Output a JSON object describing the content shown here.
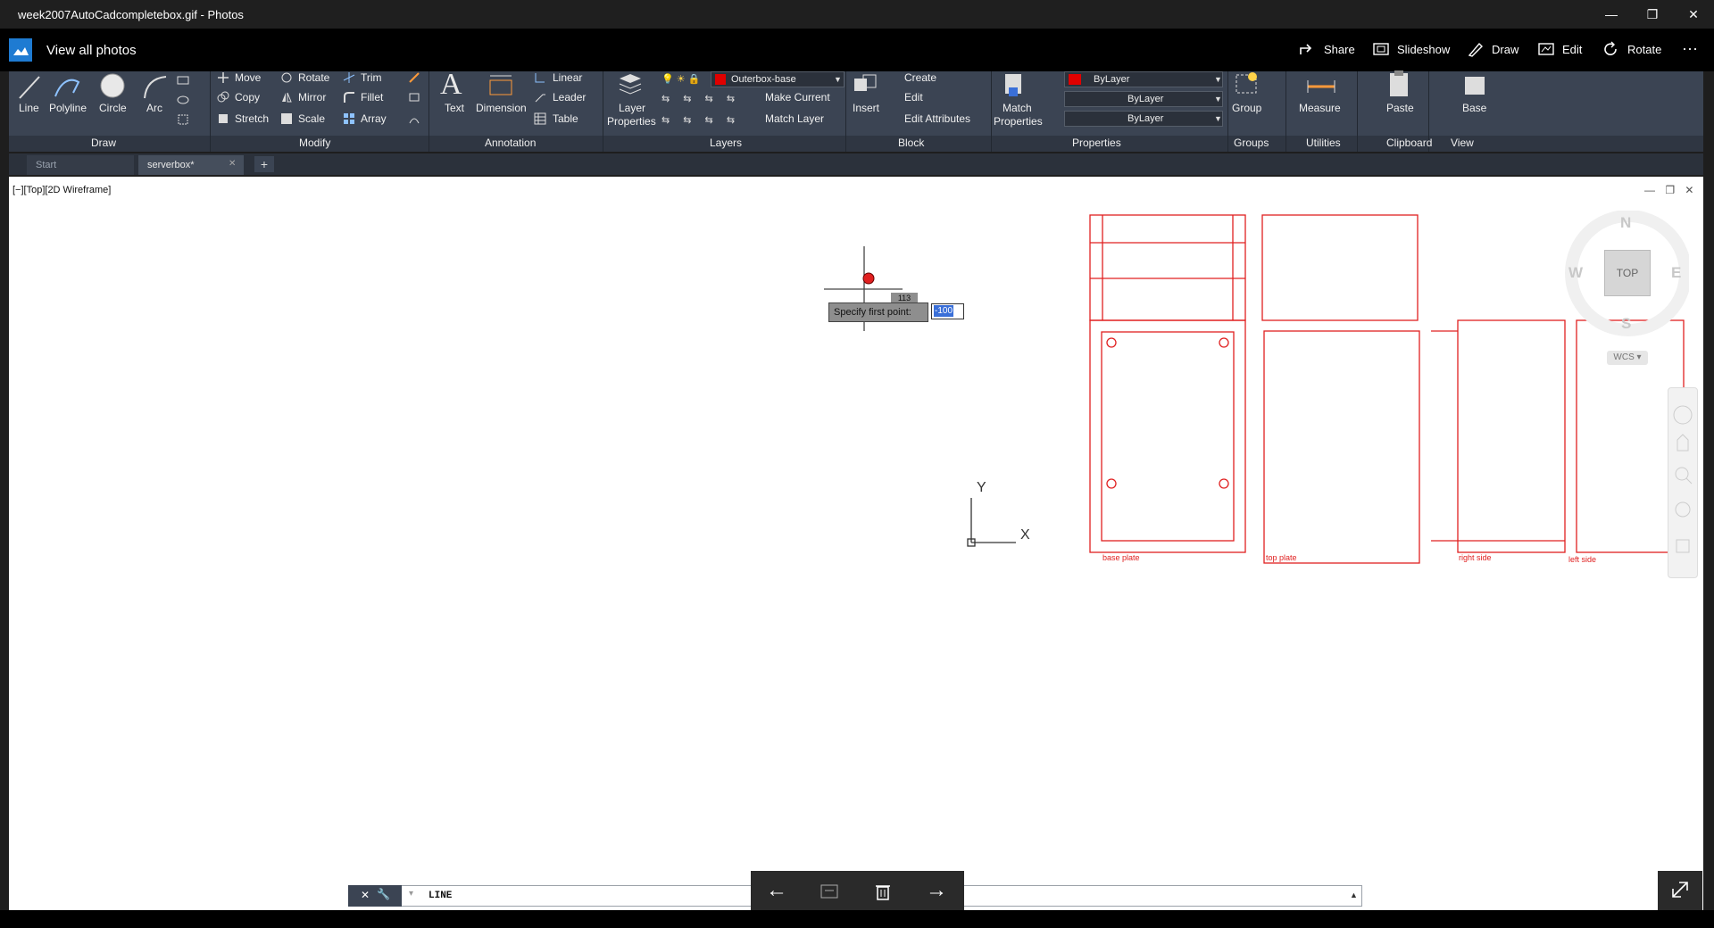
{
  "window": {
    "title": "week2007AutoCadcompletebox.gif - Photos",
    "controls": {
      "minimize": "—",
      "maximize": "❐",
      "close": "✕"
    }
  },
  "photos_bar": {
    "view_all": "View all photos",
    "buttons": {
      "share": "Share",
      "slideshow": "Slideshow",
      "draw": "Draw",
      "edit": "Edit",
      "rotate": "Rotate"
    },
    "more": "···"
  },
  "ribbon": {
    "draw": {
      "line": "Line",
      "polyline": "Polyline",
      "circle": "Circle",
      "arc": "Arc",
      "group": "Draw"
    },
    "modify": {
      "move": "Move",
      "copy": "Copy",
      "stretch": "Stretch",
      "rotate": "Rotate",
      "mirror": "Mirror",
      "scale": "Scale",
      "trim": "Trim",
      "fillet": "Fillet",
      "array": "Array",
      "group": "Modify"
    },
    "annotation": {
      "text": "Text",
      "dimension": "Dimension",
      "linear": "Linear",
      "leader": "Leader",
      "table": "Table",
      "group": "Annotation"
    },
    "layers": {
      "layer_properties_1": "Layer",
      "layer_properties_2": "Properties",
      "current_layer": "Outerbox-base",
      "make_current": "Make Current",
      "match_layer": "Match Layer",
      "group": "Layers",
      "layer_color": "#e00000"
    },
    "block": {
      "insert": "Insert",
      "create": "Create",
      "edit": "Edit",
      "edit_attributes": "Edit Attributes",
      "group": "Block"
    },
    "properties": {
      "match_1": "Match",
      "match_2": "Properties",
      "color": "ByLayer",
      "linetype": "ByLayer",
      "lineweight": "ByLayer",
      "group": "Properties"
    },
    "groups": {
      "group_btn": "Group",
      "group": "Groups"
    },
    "utilities": {
      "measure": "Measure",
      "group": "Utilities"
    },
    "clipboard": {
      "paste": "Paste",
      "group": "Clipboard"
    },
    "view": {
      "base": "Base",
      "group": "View"
    }
  },
  "file_tabs": {
    "start": "Start",
    "active": "serverbox*",
    "close": "✕",
    "add": "+"
  },
  "viewport": {
    "label": "[−][Top][2D Wireframe]",
    "tooltip": "Specify first point:",
    "dynamic_input": "-100",
    "coord_tag": "113",
    "ucs": {
      "x": "X",
      "y": "Y"
    }
  },
  "viewcube": {
    "n": "N",
    "s": "S",
    "e": "E",
    "w": "W",
    "face": "TOP",
    "wcs": "WCS"
  },
  "drawing_labels": {
    "base_plate": "base plate",
    "top_plate": "top plate",
    "right_side": "right side",
    "left_side": "left side"
  },
  "command_line": {
    "text": "LINE"
  },
  "nav": {
    "prev": "←",
    "next": "→"
  },
  "colors": {
    "drawing": "#e02020",
    "accent": "#1e7bd2"
  }
}
